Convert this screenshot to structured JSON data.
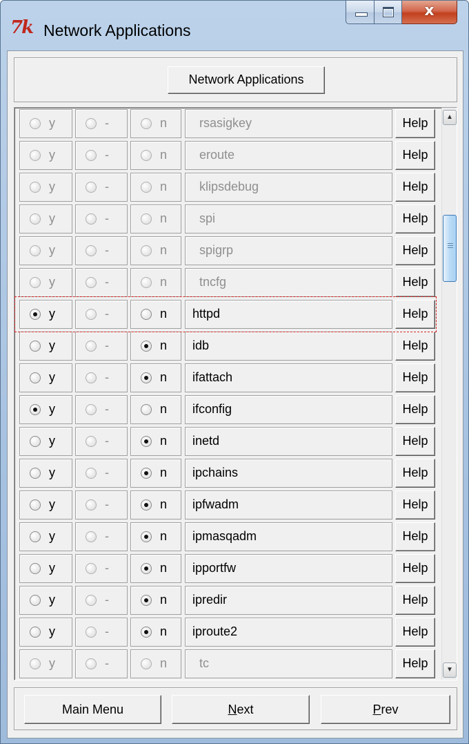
{
  "window": {
    "title": "Network Applications",
    "logo_text": "7k",
    "controls": {
      "minimize": "minimize",
      "maximize": "maximize",
      "close_glyph": "x"
    }
  },
  "header": {
    "button_label": "Network Applications"
  },
  "rows": [
    {
      "name": "rsasigkey",
      "selected": "none",
      "enabled": false,
      "y": "y",
      "dash": "-",
      "n": "n",
      "help": "Help"
    },
    {
      "name": "eroute",
      "selected": "none",
      "enabled": false,
      "y": "y",
      "dash": "-",
      "n": "n",
      "help": "Help"
    },
    {
      "name": "klipsdebug",
      "selected": "none",
      "enabled": false,
      "y": "y",
      "dash": "-",
      "n": "n",
      "help": "Help"
    },
    {
      "name": "spi",
      "selected": "none",
      "enabled": false,
      "y": "y",
      "dash": "-",
      "n": "n",
      "help": "Help"
    },
    {
      "name": "spigrp",
      "selected": "none",
      "enabled": false,
      "y": "y",
      "dash": "-",
      "n": "n",
      "help": "Help"
    },
    {
      "name": "tncfg",
      "selected": "none",
      "enabled": false,
      "y": "y",
      "dash": "-",
      "n": "n",
      "help": "Help"
    },
    {
      "name": "httpd",
      "selected": "y",
      "enabled": true,
      "y": "y",
      "dash": "-",
      "n": "n",
      "help": "Help",
      "focused": true
    },
    {
      "name": "idb",
      "selected": "n",
      "enabled": true,
      "y": "y",
      "dash": "-",
      "n": "n",
      "help": "Help"
    },
    {
      "name": "ifattach",
      "selected": "n",
      "enabled": true,
      "y": "y",
      "dash": "-",
      "n": "n",
      "help": "Help"
    },
    {
      "name": "ifconfig",
      "selected": "y",
      "enabled": true,
      "y": "y",
      "dash": "-",
      "n": "n",
      "help": "Help"
    },
    {
      "name": "inetd",
      "selected": "n",
      "enabled": true,
      "y": "y",
      "dash": "-",
      "n": "n",
      "help": "Help"
    },
    {
      "name": "ipchains",
      "selected": "n",
      "enabled": true,
      "y": "y",
      "dash": "-",
      "n": "n",
      "help": "Help"
    },
    {
      "name": "ipfwadm",
      "selected": "n",
      "enabled": true,
      "y": "y",
      "dash": "-",
      "n": "n",
      "help": "Help"
    },
    {
      "name": "ipmasqadm",
      "selected": "n",
      "enabled": true,
      "y": "y",
      "dash": "-",
      "n": "n",
      "help": "Help"
    },
    {
      "name": "ipportfw",
      "selected": "n",
      "enabled": true,
      "y": "y",
      "dash": "-",
      "n": "n",
      "help": "Help"
    },
    {
      "name": "ipredir",
      "selected": "n",
      "enabled": true,
      "y": "y",
      "dash": "-",
      "n": "n",
      "help": "Help"
    },
    {
      "name": "iproute2",
      "selected": "n",
      "enabled": true,
      "y": "y",
      "dash": "-",
      "n": "n",
      "help": "Help"
    },
    {
      "name": "tc",
      "selected": "none",
      "enabled": false,
      "y": "y",
      "dash": "-",
      "n": "n",
      "help": "Help"
    }
  ],
  "scrollbar": {
    "up_icon": "▲",
    "down_icon": "▼"
  },
  "footer": {
    "main_menu": "Main Menu",
    "next": "Next",
    "prev": "Prev"
  }
}
